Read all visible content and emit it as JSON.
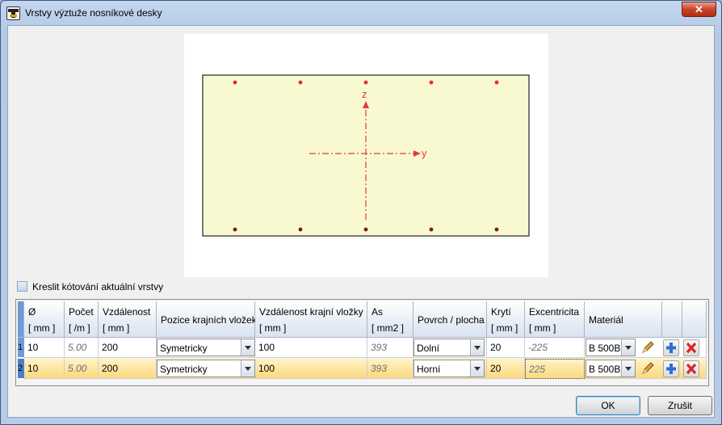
{
  "window": {
    "title": "Vrstvy výztuže nosníkové desky",
    "close_label": "✕"
  },
  "preview": {
    "axis_z": "z",
    "axis_y": "y",
    "section_fill": "#f9f9d1",
    "top_bar_color": "#e8282a",
    "bottom_bar_color": "#7a1a1a",
    "axis_color": "#e23b3b"
  },
  "options": {
    "draw_dimensions_label": "Kreslit kótování aktuální vrstvy"
  },
  "table": {
    "headers": [
      {
        "label": "Ø",
        "unit": "[ mm ]"
      },
      {
        "label": "Počet",
        "unit": "[ /m ]"
      },
      {
        "label": "Vzdálenost",
        "unit": "[ mm ]"
      },
      {
        "label": "Pozice krajních vložek",
        "unit": ""
      },
      {
        "label": "Vzdálenost krajní vložky",
        "unit": "[ mm ]"
      },
      {
        "label": "As",
        "unit": "[ mm2 ]"
      },
      {
        "label": "Povrch / plocha",
        "unit": ""
      },
      {
        "label": "Krytí",
        "unit": "[ mm ]"
      },
      {
        "label": "Excentricita",
        "unit": "[ mm ]"
      },
      {
        "label": "Materiál",
        "unit": ""
      },
      {
        "label": "",
        "unit": ""
      },
      {
        "label": "",
        "unit": ""
      },
      {
        "label": "",
        "unit": ""
      }
    ],
    "rows": [
      {
        "index": "1",
        "diameter": "10",
        "count": "5.00",
        "spacing": "200",
        "edge_position": "Symetricky",
        "edge_distance": "100",
        "as": "393",
        "surface": "Dolní",
        "cover": "20",
        "eccentricity": "-225",
        "material": "B 500B"
      },
      {
        "index": "2",
        "diameter": "10",
        "count": "5.00",
        "spacing": "200",
        "edge_position": "Symetricky",
        "edge_distance": "100",
        "as": "393",
        "surface": "Horní",
        "cover": "20",
        "eccentricity": "225",
        "material": "B 500B"
      }
    ],
    "icons": {
      "edit": "pencil-icon",
      "add": "plus-icon",
      "delete": "delete-x-icon"
    }
  },
  "buttons": {
    "ok": "OK",
    "cancel": "Zrušit"
  }
}
